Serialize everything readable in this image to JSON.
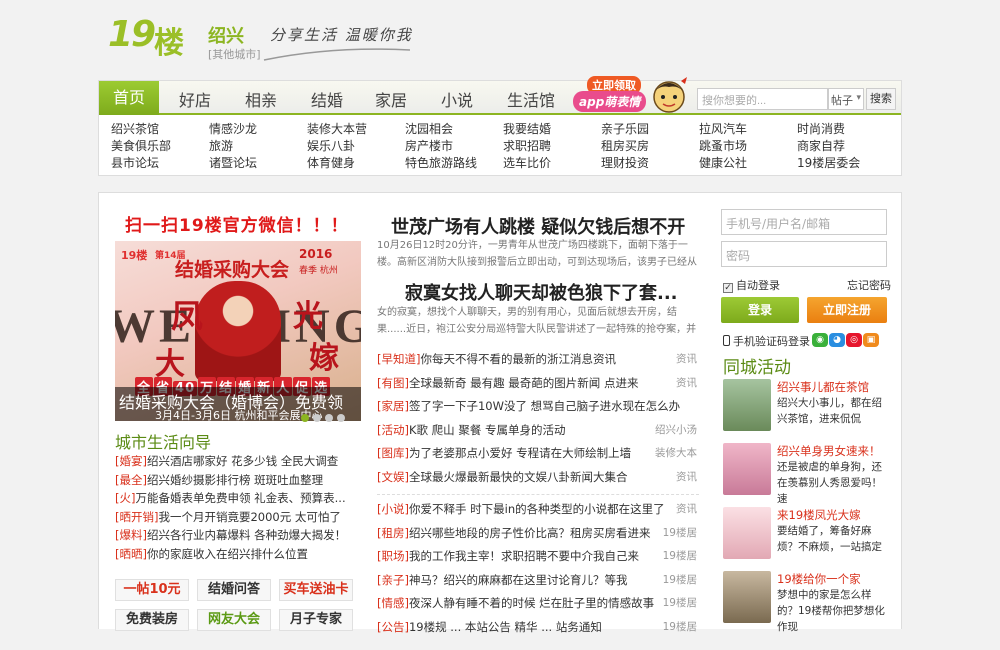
{
  "header": {
    "logo_num": "19",
    "logo_char": "楼",
    "city": "绍兴",
    "city_sub": "[其他城市]",
    "slogan": "分享生活 温暖你我"
  },
  "nav": {
    "items": [
      "首页",
      "好店",
      "相亲",
      "结婚",
      "家居",
      "小说",
      "生活馆"
    ],
    "promo_line1": "立即领取",
    "promo_line2": "app萌表情",
    "search_placeholder": "搜你想要的...",
    "search_scope": "帖子",
    "search_button": "搜索",
    "sublinks": [
      [
        "绍兴茶馆",
        "美食俱乐部",
        "县市论坛"
      ],
      [
        "情感沙龙",
        "旅游",
        "诸暨论坛"
      ],
      [
        "装修大本营",
        "娱乐八卦",
        "体育健身"
      ],
      [
        "沈园相会",
        "房产楼市",
        "特色旅游路线"
      ],
      [
        "我要结婚",
        "求职招聘",
        "选车比价"
      ],
      [
        "亲子乐园",
        "租房买房",
        "理财投资"
      ],
      [
        "拉风汽车",
        "跳蚤市场",
        "健康公社"
      ],
      [
        "时尚消费",
        "商家自荐",
        "19楼居委会"
      ]
    ]
  },
  "left": {
    "qr_title": "扫一扫19楼官方微信！！！",
    "banner": {
      "brand": "19楼",
      "edition": "第14届",
      "title": "结婚采购大会",
      "year": "2016",
      "season": "春季 杭州",
      "wedding_word": "WEDDING",
      "feng": "凤",
      "guang": "光",
      "da": "大",
      "jia": "嫁",
      "row_chars": [
        "全",
        "省",
        "40",
        "万",
        "结",
        "婚",
        "新",
        "人",
        "促",
        "选"
      ],
      "caption": "结婚采购大会（婚博会）免费领",
      "date": "3月4日-3月6日 杭州和平会展中心"
    },
    "guide_title": "城市生活向导",
    "guide": [
      {
        "tag": "[婚宴]",
        "text": "绍兴酒店哪家好 花多少钱 全民大调查"
      },
      {
        "tag": "[最全]",
        "text": "绍兴婚纱摄影排行榜 斑斑吐血整理"
      },
      {
        "tag": "[火]",
        "text": "万能备婚表单免费申领 礼金表、预算表..."
      },
      {
        "tag": "[晒开销]",
        "text": "我一个月开销竟要2000元 太可怕了"
      },
      {
        "tag": "[爆料]",
        "text": "绍兴各行业内幕爆料 各种劲爆大揭发！"
      },
      {
        "tag": "[晒晒]",
        "text": "你的家庭收入在绍兴排什么位置"
      }
    ],
    "buttons": [
      {
        "label": "一帖10元",
        "color": "#d9311c"
      },
      {
        "label": "结婚问答",
        "color": "#333333"
      },
      {
        "label": "买车送油卡",
        "color": "#d9311c"
      },
      {
        "label": "免费装房",
        "color": "#333333"
      },
      {
        "label": "网友大会",
        "color": "#5b9a14"
      },
      {
        "label": "月子专家",
        "color": "#333333"
      }
    ]
  },
  "middle": {
    "headline1": "世茂广场有人跳楼 疑似欠钱后想不开",
    "summary1": "10月26日12时20分许，一男青年从世茂广场四楼跳下，面朝下落于一楼。高新区消防大队接到报警后立即出动，可到达现场后，该男子已经从",
    "headline2": "寂寞女找人聊天却被色狼下了套...",
    "summary2": "女的寂寞，想找个人聊聊天，男的别有用心，见面后就想去开房，结果......近日，袍江公安分局巡特警大队民警讲述了一起特殊的抢夺案，并",
    "news": [
      [
        {
          "tag": "[早知道]",
          "text": "你每天不得不看的最新的浙江消息资讯",
          "src": "资讯"
        },
        {
          "tag": "[有图]",
          "text": "全球最新奇 最有趣 最奇葩的图片新闻 点进来",
          "src": "资讯"
        },
        {
          "tag": "[家居]",
          "text": "签了字一下子10W没了 想骂自己脑子进水现在怎么办",
          "src": ""
        },
        {
          "tag": "[活动]",
          "text": "K歌 爬山 聚餐 专属单身的活动",
          "src": "绍兴小汤"
        },
        {
          "tag": "[图库]",
          "text": "为了老婆那点小爱好 专程请在大师绘制上墙",
          "src": "装修大本"
        },
        {
          "tag": "[文娱]",
          "text": "全球最火爆最新最快的文娱八卦新闻大集合",
          "src": "资讯"
        }
      ],
      [
        {
          "tag": "[小说]",
          "text": "你爱不释手 时下最in的各种类型的小说都在这里了",
          "src": "资讯"
        },
        {
          "tag": "[租房]",
          "text": "绍兴哪些地段的房子性价比高？租房买房看进来",
          "src": "19楼居"
        },
        {
          "tag": "[职场]",
          "text": "我的工作我主宰！求职招聘不要中介我自己来",
          "src": "19楼居"
        },
        {
          "tag": "[亲子]",
          "text": "神马？绍兴的麻麻都在这里讨论育儿？等我",
          "src": "19楼居"
        },
        {
          "tag": "[情感]",
          "text": "夜深人静有睡不着的时候 烂在肚子里的情感故事",
          "src": "19楼居"
        },
        {
          "tag": "[公告]",
          "text": "19楼规 ... 本站公告 精华 ... 站务通知",
          "src": "19楼居"
        }
      ]
    ]
  },
  "right": {
    "user_placeholder": "手机号/用户名/邮箱",
    "pass_placeholder": "密码",
    "auto_login": "自动登录",
    "forgot": "忘记密码",
    "login": "登录",
    "register": "立即注册",
    "sms_login": "手机验证码登录",
    "activity_title": "同城活动",
    "activities": [
      {
        "title": "绍兴事儿都在茶馆",
        "desc": "绍兴大小事儿，都在绍兴茶馆，进来侃侃",
        "thumb": "#7a9a6a"
      },
      {
        "title": "绍兴单身男女速来！",
        "desc": "还是被虐的单身狗，还在羡慕别人秀恩爱吗！速",
        "thumb": "#d98aa8"
      },
      {
        "title": "来19楼凤光大嫁",
        "desc": "要结婚了，筹备好麻烦？不麻烦，一站搞定",
        "thumb": "#e8b8c0"
      },
      {
        "title": "19楼给你一个家",
        "desc": "梦想中的家是怎么样的？19楼帮你把梦想化作现",
        "thumb": "#9a8a70"
      }
    ]
  },
  "colors": {
    "brand_green": "#8cb521",
    "link_red": "#d9311c",
    "register_orange": "#ea7f10"
  }
}
